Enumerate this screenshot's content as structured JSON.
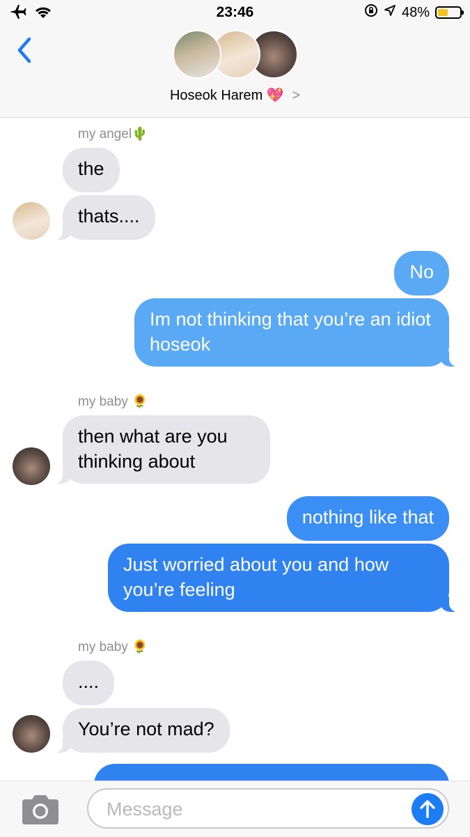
{
  "status_bar": {
    "time": "23:46",
    "battery_percent": "48%",
    "battery_level": 0.48,
    "icons": [
      "airplane-icon",
      "wifi-icon",
      "orientation-lock-icon",
      "location-icon",
      "battery-icon"
    ]
  },
  "header": {
    "title": "Hoseok Harem 💖",
    "chevron": ">",
    "back_icon": "chevron-left-icon"
  },
  "colors": {
    "accent": "#1c7cf3",
    "incoming_bubble": "#e5e5ea",
    "outgoing_light": "#5aa9f5",
    "outgoing_dark": "#2f82f0",
    "sender_gray": "#8e8e93"
  },
  "messages": [
    {
      "sender": "my angel🌵",
      "text": "the"
    },
    {
      "text": "thats...."
    },
    {
      "text": "No"
    },
    {
      "text": "Im not thinking that you’re an idiot hoseok"
    },
    {
      "sender": "my baby 🌻",
      "text": "then what are you thinking about"
    },
    {
      "text": "nothing like that"
    },
    {
      "text": "Just worried about you and how you’re feeling"
    },
    {
      "sender": "my baby 🌻",
      "text": "...."
    },
    {
      "text": "You’re not mad?"
    }
  ],
  "composer": {
    "placeholder": "Message",
    "camera_icon": "camera-icon",
    "send_icon": "arrow-up-icon"
  }
}
